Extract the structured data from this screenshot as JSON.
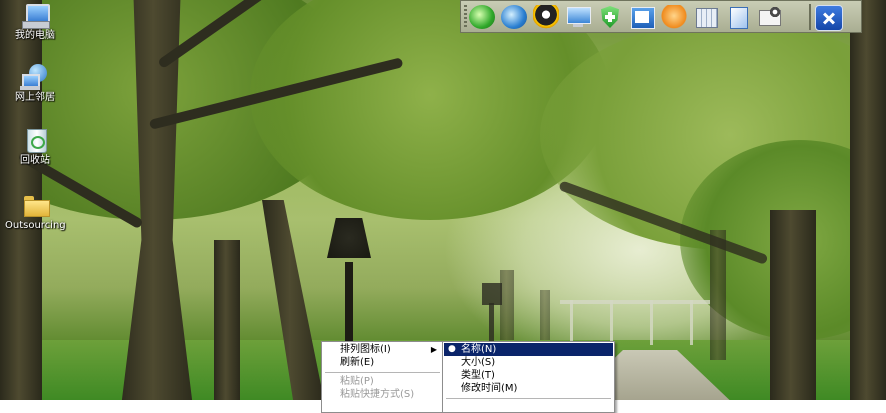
{
  "desktop": {
    "icons": [
      {
        "label": "我的电脑",
        "icon": "my-computer-icon"
      },
      {
        "label": "网上邻居",
        "icon": "network-places-icon"
      },
      {
        "label": "回收站",
        "icon": "recycle-bin-icon"
      },
      {
        "label": "Outsourcing",
        "icon": "folder-icon"
      }
    ]
  },
  "toolbar": {
    "icons": [
      "ie-green-icon",
      "internet-explorer-icon",
      "qq-penguin-icon",
      "monitor-icon",
      "shield-icon",
      "word-icon",
      "orange-mascot-icon",
      "calculator-icon",
      "document-icon",
      "settings-tools-icon",
      "tools-icon"
    ]
  },
  "context_menu": {
    "items": [
      {
        "label": "排列图标(I)",
        "highlighted": false,
        "disabled": false,
        "submenu": true
      },
      {
        "label": "刷新(E)",
        "highlighted": false,
        "disabled": false,
        "submenu": false
      },
      {
        "label": "粘贴(P)",
        "highlighted": false,
        "disabled": true,
        "submenu": false
      },
      {
        "label": "粘贴快捷方式(S)",
        "highlighted": false,
        "disabled": true,
        "submenu": false
      }
    ],
    "submenu_glyph": "▶"
  },
  "arrange_submenu": {
    "items": [
      {
        "label": "名称(N)",
        "selected": true
      },
      {
        "label": "大小(S)",
        "selected": false
      },
      {
        "label": "类型(T)",
        "selected": false
      },
      {
        "label": "修改时间(M)",
        "selected": false
      }
    ],
    "bullet": "●"
  },
  "colors": {
    "menu_highlight": "#0a246a",
    "menu_disabled": "#9a9a9a"
  }
}
